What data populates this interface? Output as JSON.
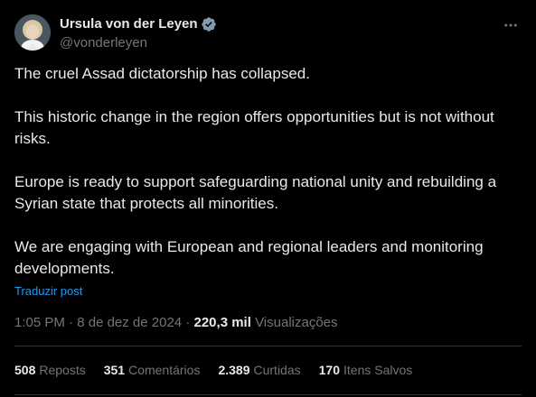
{
  "author": {
    "display_name": "Ursula von der Leyen",
    "handle": "@vonderleyen",
    "avatar_icon": "avatar-photo",
    "verified_icon": "verified-badge-icon",
    "verified_color": "#829aab"
  },
  "more_icon": "more-horizontal-icon",
  "tweet": {
    "paragraphs": [
      "The cruel Assad dictatorship has collapsed.",
      "This historic change in the region offers opportunities but is not without\nrisks.",
      "Europe is ready to support safeguarding national unity and rebuilding a\nSyrian state that protects all minorities.",
      "We are engaging with European and regional leaders and monitoring\ndevelopments."
    ],
    "translate_label": "Traduzir post"
  },
  "meta": {
    "time": "1:05 PM",
    "separator": "·",
    "date": "8 de dez de 2024",
    "views_count": "220,3 mil",
    "views_label": "Visualizações"
  },
  "stats": [
    {
      "count": "508",
      "label": "Reposts"
    },
    {
      "count": "351",
      "label": "Comentários"
    },
    {
      "count": "2.389",
      "label": "Curtidas"
    },
    {
      "count": "170",
      "label": "Itens Salvos"
    }
  ],
  "colors": {
    "background": "#000000",
    "text": "#e7e9ea",
    "secondary_text": "#71767b",
    "link": "#1d9bf0",
    "divider": "#2f3336"
  }
}
